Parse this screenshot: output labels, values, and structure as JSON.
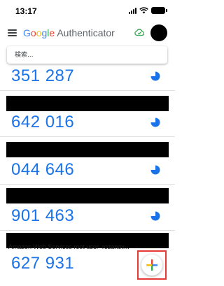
{
  "status_bar": {
    "time": "13:17"
  },
  "header": {
    "logo_word": [
      "G",
      "o",
      "o",
      "g",
      "l",
      "e"
    ],
    "app_name": "Authenticator",
    "colors": {
      "blue": "#4285F4",
      "red": "#EA4335",
      "yellow": "#FBBC05",
      "green": "#34A853"
    }
  },
  "search": {
    "placeholder": "検索..."
  },
  "codes": [
    {
      "code": "351 287"
    },
    {
      "code": "642 016"
    },
    {
      "code": "044 646"
    },
    {
      "code": "901 463"
    },
    {
      "code": "627 931"
    }
  ],
  "partial_account_label": "Amazon Web Services root user_rozanov...",
  "fab": {
    "label": "+",
    "icon": "add-icon"
  },
  "accent_color": "#1a73e8"
}
